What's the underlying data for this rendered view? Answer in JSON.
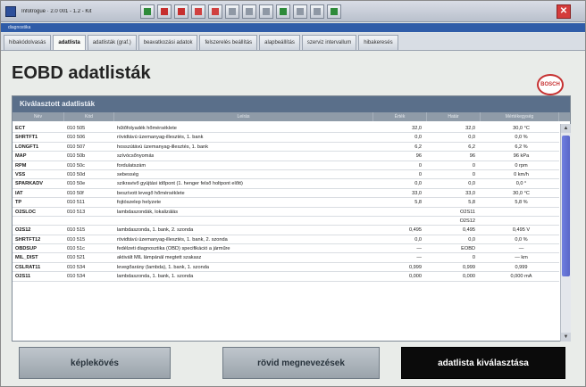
{
  "window": {
    "title": "Infotrogue · 2.0 001 - 1.2 - Kit",
    "close_glyph": "✕"
  },
  "toolbar": {
    "buttons": [
      {
        "icon": "back-arrow-icon",
        "color": "#2e8b3a"
      },
      {
        "icon": "stop-icon",
        "color": "#c62f2f"
      },
      {
        "icon": "info-icon",
        "color": "#c62f2f"
      },
      {
        "icon": "folder-icon",
        "color": "#d04040"
      },
      {
        "icon": "help-icon",
        "color": "#d04040"
      },
      {
        "icon": "grid-icon",
        "color": "#8f98a5"
      },
      {
        "icon": "list-icon",
        "color": "#8f98a5"
      },
      {
        "icon": "print-icon",
        "color": "#8f98a5"
      },
      {
        "icon": "image-icon",
        "color": "#2e8b3a"
      },
      {
        "icon": "doc-icon",
        "color": "#8f98a5"
      },
      {
        "icon": "chart-icon",
        "color": "#8f98a5"
      },
      {
        "icon": "green-check-icon",
        "color": "#2e8b3a"
      }
    ]
  },
  "subbar": {
    "label": "diagnostika"
  },
  "tabs": [
    {
      "label": "hibakódolvasás",
      "active": false
    },
    {
      "label": "adatlista",
      "active": true
    },
    {
      "label": "adatlisták (graf.)",
      "active": false
    },
    {
      "label": "beavatkozási adatok",
      "active": false
    },
    {
      "label": "felszerelés beállítás",
      "active": false
    },
    {
      "label": "alapbeállítás",
      "active": false
    },
    {
      "label": "szerviz intervallum",
      "active": false
    },
    {
      "label": "hibakeresés",
      "active": false
    }
  ],
  "page": {
    "title": "EOBD adatlisták",
    "logo_text": "BOSCH"
  },
  "panel": {
    "header": "Kiválasztott adatlisták",
    "columns": [
      "Név",
      "Kód",
      "Leírás",
      "Érték",
      "Határ",
      "Mértékegység"
    ],
    "rows": [
      {
        "id": "ECT",
        "code": "010 505",
        "desc": "hűtőfolyadék hőmérséklete",
        "v1": "32,0",
        "v2": "32,0",
        "unit": "30,0 °C"
      },
      {
        "id": "SHRTFT1",
        "code": "010 506",
        "desc": "rövidtávú üzemanyag-illesztés, 1. bank",
        "v1": "0,0",
        "v2": "0,0",
        "unit": "0,0 %"
      },
      {
        "id": "LONGFT1",
        "code": "010 507",
        "desc": "hosszútávú üzemanyag-illesztés, 1. bank",
        "v1": "6,2",
        "v2": "6,2",
        "unit": "6,2 %"
      },
      {
        "id": "MAP",
        "code": "010 50b",
        "desc": "szívócsőnyomás",
        "v1": "96",
        "v2": "96",
        "unit": "96 kPa"
      },
      {
        "id": "RPM",
        "code": "010 50c",
        "desc": "fordulatszám",
        "v1": "0",
        "v2": "0",
        "unit": "0 rpm"
      },
      {
        "id": "VSS",
        "code": "010 50d",
        "desc": "sebesség",
        "v1": "0",
        "v2": "0",
        "unit": "0 km/h"
      },
      {
        "id": "SPARKADV",
        "code": "010 50e",
        "desc": "szikravivő gyújtási időpont (1. henger felső holtpont előtt)",
        "v1": "0,0",
        "v2": "0,0",
        "unit": "0,0 °"
      },
      {
        "id": "IAT",
        "code": "010 50f",
        "desc": "beszívott levegő hőmérséklete",
        "v1": "33,0",
        "v2": "33,0",
        "unit": "30,0 °C"
      },
      {
        "id": "TP",
        "code": "010 511",
        "desc": "fojtószelep helyzete",
        "v1": "5,8",
        "v2": "5,8",
        "unit": "5,8 %"
      },
      {
        "id": "O2SLOC",
        "code": "010 513",
        "desc": "lambdaszondák, lokalizálás",
        "v1": "",
        "v2": "O2S11",
        "unit": ""
      },
      {
        "id": "",
        "code": "",
        "desc": "",
        "v1": "",
        "v2": "O2S12",
        "unit": ""
      },
      {
        "id": "O2S12",
        "code": "010 515",
        "desc": "lambdaszonda, 1. bank, 2. szonda",
        "v1": "0,495",
        "v2": "0,495",
        "unit": "0,495 V"
      },
      {
        "id": "SHRTFT12",
        "code": "010 515",
        "desc": "rövidtávú üzemanyag-illesztés, 1. bank, 2. szonda",
        "v1": "0,0",
        "v2": "0,0",
        "unit": "0,0 %"
      },
      {
        "id": "OBDSUP",
        "code": "010 51c",
        "desc": "fedélzeti diagnosztika (OBD) specifikáció a járműre",
        "v1": "—",
        "v2": "EOBD",
        "unit": "—"
      },
      {
        "id": "MIL_DIST",
        "code": "010 521",
        "desc": "aktivált MIL lámpánál megtett szakasz",
        "v1": "—",
        "v2": "0",
        "unit": "— km"
      },
      {
        "id": "CSLRAT11",
        "code": "010 534",
        "desc": "levegőarány (lambda), 1. bank, 1. szonda",
        "v1": "0,999",
        "v2": "0,999",
        "unit": "0,999"
      },
      {
        "id": "O2S11",
        "code": "010 534",
        "desc": "lambdaszonda, 1. bank, 1. szonda",
        "v1": "0,000",
        "v2": "0,000",
        "unit": "0,000 mA"
      }
    ]
  },
  "scrollbar": {
    "up_glyph": "▲",
    "down_glyph": "▼",
    "position_fraction": 0.05
  },
  "footer": {
    "buttons": [
      {
        "label": "képlekövés",
        "style": "grey"
      },
      {
        "label": "rövid megnevezések",
        "style": "grey"
      },
      {
        "label": "adatlista kiválasztása",
        "style": "dark"
      }
    ]
  }
}
